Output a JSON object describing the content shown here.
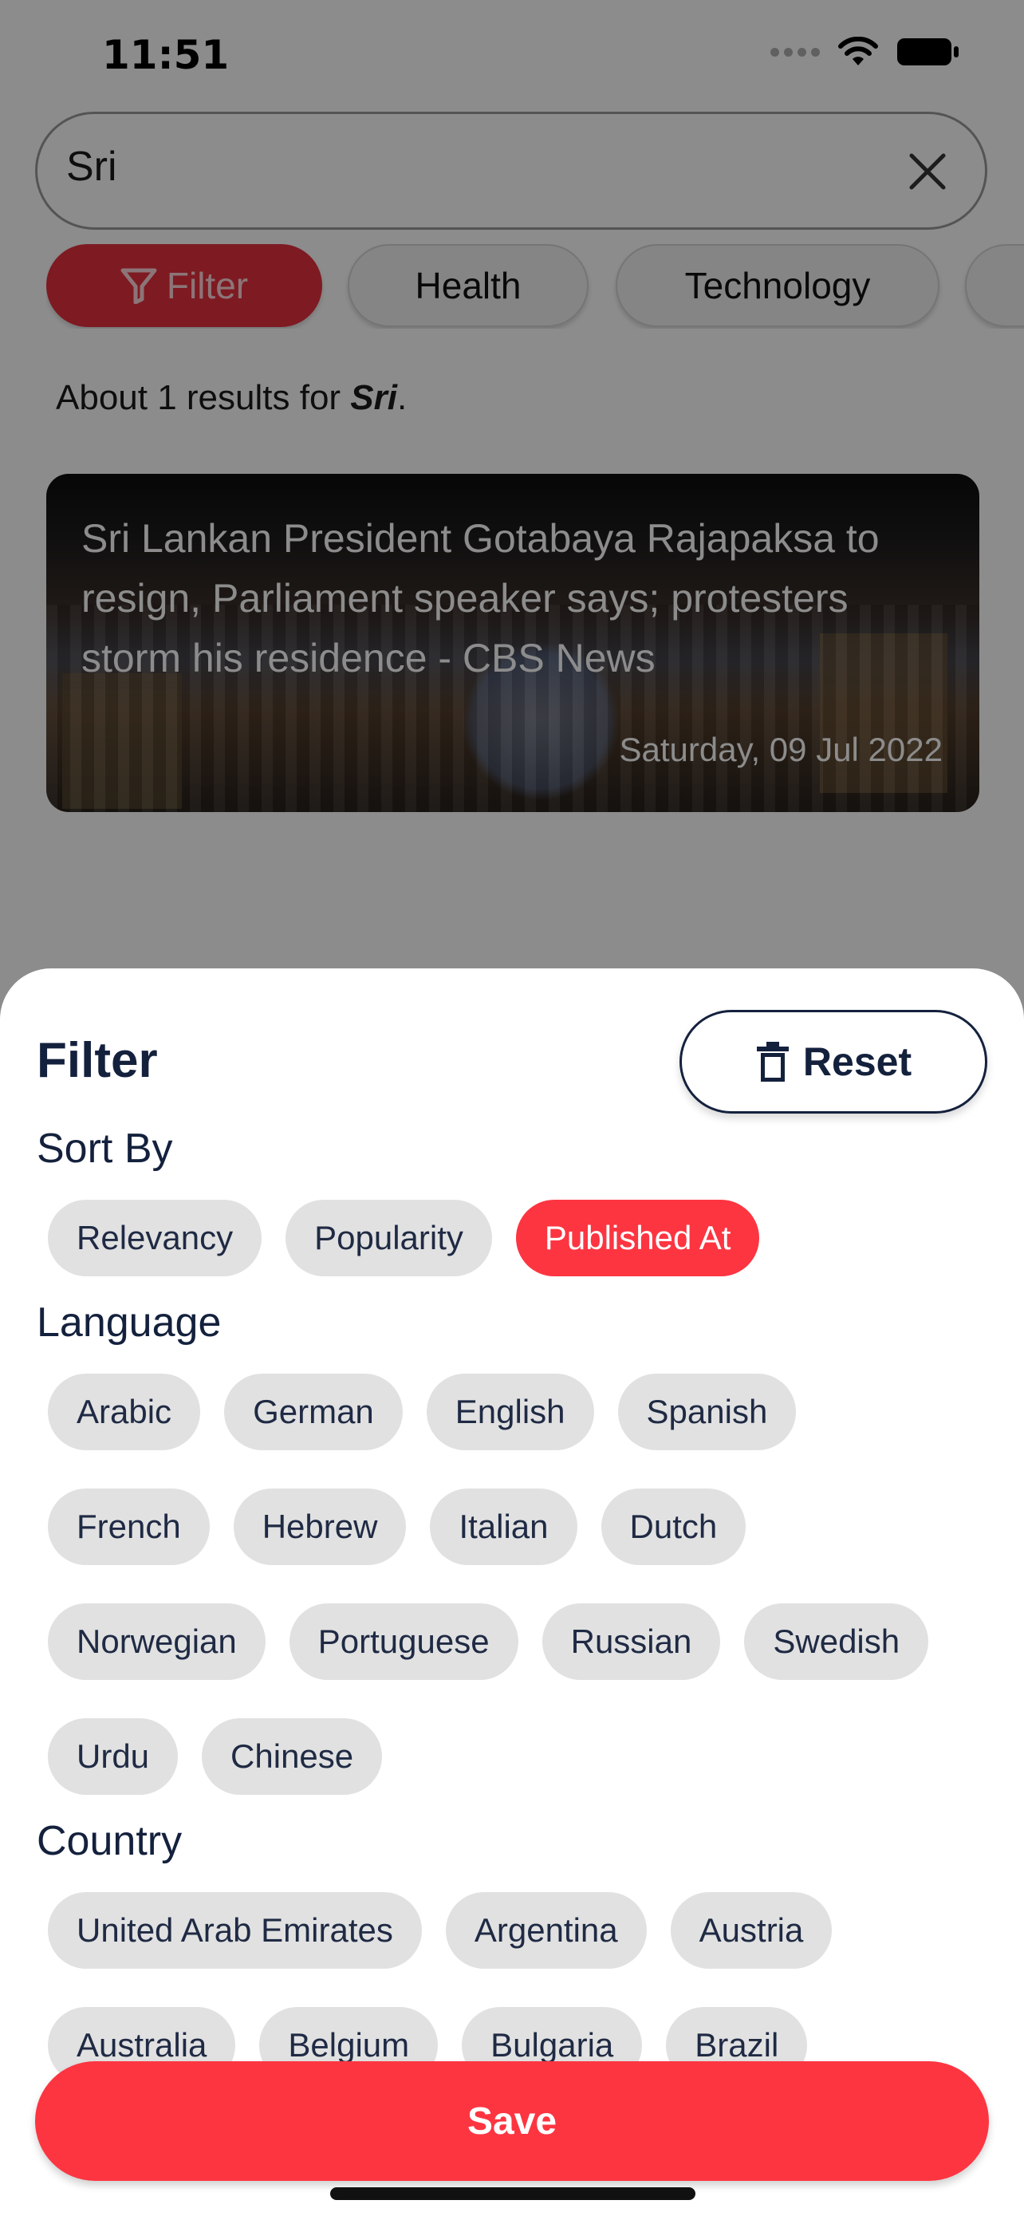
{
  "status_bar": {
    "time": "11:51"
  },
  "search": {
    "query": "Sri"
  },
  "top_chips": [
    {
      "label": "Filter",
      "active": true
    },
    {
      "label": "Health",
      "active": false
    },
    {
      "label": "Technology",
      "active": false
    }
  ],
  "results": {
    "prefix": "About 1 results for ",
    "term": "Sri",
    "suffix": "."
  },
  "news": [
    {
      "title": "Sri Lankan President Gotabaya Rajapaksa to resign, Parliament speaker says; protesters storm his residence - CBS News",
      "date": "Saturday, 09 Jul 2022"
    }
  ],
  "filter_sheet": {
    "title": "Filter",
    "reset_label": "Reset",
    "sort_by": {
      "label": "Sort By",
      "options": [
        "Relevancy",
        "Popularity",
        "Published At"
      ],
      "selected": "Published At"
    },
    "language": {
      "label": "Language",
      "options": [
        "Arabic",
        "German",
        "English",
        "Spanish",
        "French",
        "Hebrew",
        "Italian",
        "Dutch",
        "Norwegian",
        "Portuguese",
        "Russian",
        "Swedish",
        "Urdu",
        "Chinese"
      ]
    },
    "country": {
      "label": "Country",
      "options": [
        "United Arab Emirates",
        "Argentina",
        "Austria",
        "Australia",
        "Belgium",
        "Bulgaria",
        "Brazil"
      ]
    },
    "save_label": "Save"
  },
  "colors": {
    "accent": "#fd3541",
    "chip_bg": "#e1e1e1",
    "text_dark": "#14213d"
  },
  "icons": {
    "filter": "funnel-icon",
    "reset": "trash-icon",
    "clear": "close-icon"
  }
}
